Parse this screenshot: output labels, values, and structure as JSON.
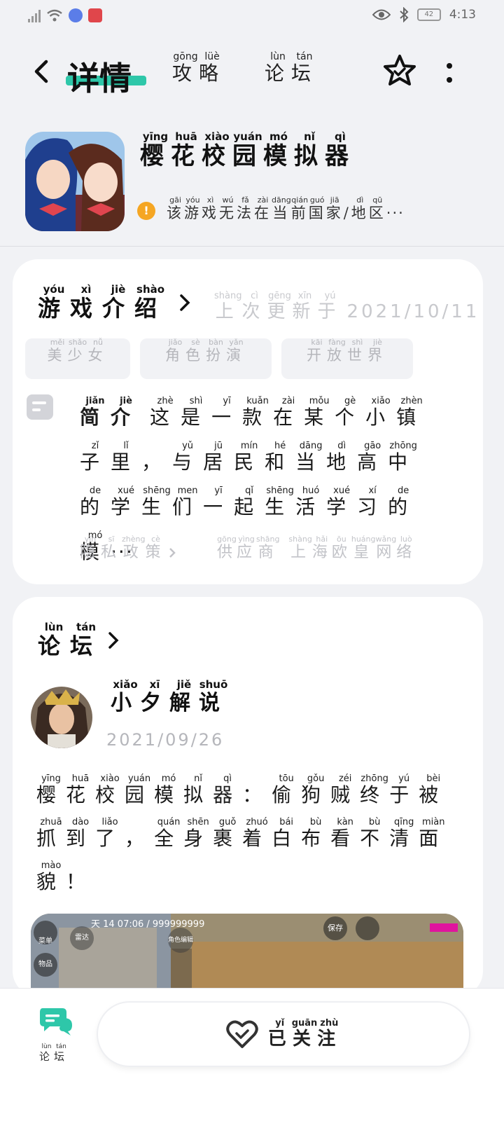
{
  "status_bar": {
    "time": "4:13",
    "battery": "42"
  },
  "nav": {
    "title": "详情",
    "tabs": [
      {
        "chars": [
          "攻",
          "略"
        ],
        "pinyin": [
          "gōng",
          "lüè"
        ]
      },
      {
        "chars": [
          "论",
          "坛"
        ],
        "pinyin": [
          "lùn",
          "tán"
        ]
      }
    ]
  },
  "game": {
    "name": {
      "chars": [
        "樱",
        "花",
        "校",
        "园",
        "模",
        "拟",
        "器"
      ],
      "pinyin": [
        "yīng",
        "huā",
        "xiào",
        "yuán",
        "mó",
        "nǐ",
        "qì"
      ]
    },
    "notice": {
      "chars": [
        "该",
        "游",
        "戏",
        "无",
        "法",
        "在",
        "当",
        "前",
        "国",
        "家",
        "/",
        "地",
        "区"
      ],
      "pinyin": [
        "gāi",
        "yóu",
        "xì",
        "wú",
        "fǎ",
        "zài",
        "dāng",
        "qián",
        "guó",
        "jiā",
        "",
        "dì",
        "qū"
      ],
      "ellipsis": "···"
    }
  },
  "intro": {
    "title": {
      "chars": [
        "游",
        "戏",
        "介",
        "绍"
      ],
      "pinyin": [
        "yóu",
        "xì",
        "jiè",
        "shào"
      ]
    },
    "update_label": {
      "chars": [
        "上",
        "次",
        "更",
        "新",
        "于"
      ],
      "pinyin": [
        "shàng",
        "cì",
        "gēng",
        "xīn",
        "yú"
      ]
    },
    "update_date": "2021/10/11",
    "tags": [
      {
        "chars": [
          "美",
          "少",
          "女"
        ],
        "pinyin": [
          "měi",
          "shǎo",
          "nǚ"
        ]
      },
      {
        "chars": [
          "角",
          "色",
          "扮",
          "演"
        ],
        "pinyin": [
          "jiǎo",
          "sè",
          "bàn",
          "yǎn"
        ]
      },
      {
        "chars": [
          "开",
          "放",
          "世",
          "界"
        ],
        "pinyin": [
          "kāi",
          "fàng",
          "shì",
          "jiè"
        ]
      }
    ],
    "summary_label": {
      "chars": [
        "简",
        "介"
      ],
      "pinyin": [
        "jiǎn",
        "jiè"
      ]
    },
    "summary": {
      "chars": [
        "这",
        "是",
        "一",
        "款",
        "在",
        "某",
        "个",
        "小",
        "镇",
        "子",
        "里",
        "，",
        "与",
        "居",
        "民",
        "和",
        "当",
        "地",
        "高",
        "中",
        "的",
        "学",
        "生",
        "们",
        "一",
        "起",
        "生",
        "活",
        "学",
        "习",
        "的",
        "模"
      ],
      "pinyin": [
        "zhè",
        "shì",
        "yī",
        "kuǎn",
        "zài",
        "mǒu",
        "gè",
        "xiǎo",
        "zhèn",
        "zǐ",
        "lǐ",
        "",
        "yǔ",
        "jū",
        "mín",
        "hé",
        "dāng",
        "dì",
        "gāo",
        "zhōng",
        "de",
        "xué",
        "shēng",
        "men",
        "yī",
        "qǐ",
        "shēng",
        "huó",
        "xué",
        "xí",
        "de",
        "mó"
      ],
      "ellipsis": "···"
    },
    "policy": {
      "chars": [
        "隐",
        "私",
        "政",
        "策"
      ],
      "pinyin": [
        "yǐn",
        "sī",
        "zhèng",
        "cè"
      ]
    },
    "supplier": {
      "chars": [
        "供",
        "应",
        "商",
        " ",
        "上",
        "海",
        "欧",
        "皇",
        "网",
        "络"
      ],
      "pinyin": [
        "gōng",
        "yìng",
        "shāng",
        "",
        "shàng",
        "hǎi",
        "ōu",
        "huáng",
        "wǎng",
        "luò"
      ]
    }
  },
  "forum": {
    "title": {
      "chars": [
        "论",
        "坛"
      ],
      "pinyin": [
        "lùn",
        "tán"
      ]
    },
    "post": {
      "author": {
        "chars": [
          "小",
          "夕",
          "解",
          "说"
        ],
        "pinyin": [
          "xiǎo",
          "xī",
          "jiě",
          "shuō"
        ]
      },
      "date": "2021/09/26",
      "text": {
        "chars": [
          "樱",
          "花",
          "校",
          "园",
          "模",
          "拟",
          "器",
          "：",
          "偷",
          "狗",
          "贼",
          "终",
          "于",
          "被",
          "抓",
          "到",
          "了",
          "，",
          "全",
          "身",
          "裹",
          "着",
          "白",
          "布",
          "看",
          "不",
          "清",
          "面",
          "貌",
          "！"
        ],
        "pinyin": [
          "yīng",
          "huā",
          "xiào",
          "yuán",
          "mó",
          "nǐ",
          "qì",
          "",
          "tōu",
          "gǒu",
          "zéi",
          "zhōng",
          "yú",
          "bèi",
          "zhuā",
          "dào",
          "liǎo",
          "",
          "quán",
          "shēn",
          "guǒ",
          "zhuó",
          "bái",
          "bù",
          "kàn",
          "bù",
          "qīng",
          "miàn",
          "mào",
          ""
        ]
      },
      "image_overlay": {
        "hud_text": "天 14 07:06 / 999999999",
        "buttons": [
          "菜单",
          "雷达",
          "物品",
          "角色编辑",
          "保存"
        ]
      }
    }
  },
  "bottom": {
    "forum_tab": {
      "chars": [
        "论",
        "坛"
      ],
      "pinyin": [
        "lùn",
        "tán"
      ]
    },
    "follow_button": {
      "chars": [
        "已",
        "关",
        "注"
      ],
      "pinyin": [
        "yǐ",
        "guān",
        "zhù"
      ]
    }
  },
  "colors": {
    "accent": "#2ec7a9",
    "warning": "#f5a623",
    "muted": "#c2c3c8"
  }
}
